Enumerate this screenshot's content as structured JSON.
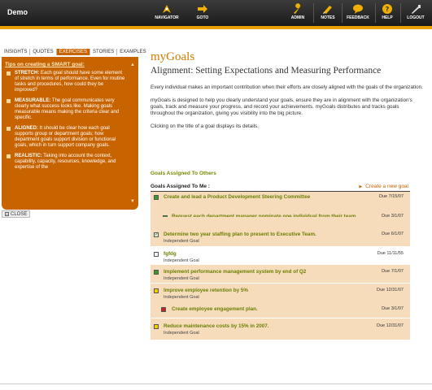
{
  "app": {
    "title": "Demo"
  },
  "nav": [
    {
      "label": "NAVIGATOR",
      "icon": "navigator-icon"
    },
    {
      "label": "GOTO",
      "icon": "goto-arrow-icon"
    },
    {
      "label": "ADMIN",
      "icon": "wrench-icon"
    },
    {
      "label": "NOTES",
      "icon": "notes-icon"
    },
    {
      "label": "FEEDBACK",
      "icon": "feedback-bubble-icon"
    },
    {
      "label": "HELP",
      "icon": "help-icon"
    },
    {
      "label": "LOGOUT",
      "icon": "logout-arrow-icon"
    }
  ],
  "colors": {
    "accent_orange": "#c86400",
    "goal_green": "#6b7f00",
    "row_shade": "#f7dcbc",
    "title_orange": "#d07c00"
  },
  "tabs": [
    "INSIGHTS",
    "QUOTES",
    "EXERCISES",
    "STORIES",
    "EXAMPLES"
  ],
  "active_tab": "EXERCISES",
  "tips": {
    "title": "Tips on creating a SMART goal:",
    "items": [
      {
        "term": "STRETCH:",
        "text": " Each goal should have some element of stretch in terms of performance. Even for routine tasks and procedures, how could they be improved?"
      },
      {
        "term": "MEASURABLE:",
        "text": " The goal communicates very clearly what success looks like. Making goals measurable means making the criteria clear and specific."
      },
      {
        "term": "ALIGNED:",
        "text": " It should be clear how each goal supports group or department goals; how department goals support division or functional goals, which in turn support company goals."
      },
      {
        "term": "REALISTIC:",
        "text": " Taking into account the context, capability, capacity, resources, knowledge, and expertise of the"
      }
    ]
  },
  "close_label": "CLOSE",
  "main": {
    "title": "myGoals",
    "subtitle": "Alignment: Setting Expectations and Measuring Performance",
    "para1": "Every individual makes an important contribution when their efforts are closely aligned with the goals of the organization.",
    "para2": "myGoals is designed to help you clearly understand your goals, ensure they are in alignment with the organization's goals, track and measure your progress, and record your achievements. myGoals distributes and tracks goals throughout the organization, giving you visibility into the big picture.",
    "para3": "Clicking on the title of a goal displays its details.",
    "section_others": "Goals Assigned To Others",
    "section_me": "Goals Assigned To Me :",
    "create_link": "Create a new goal"
  },
  "goals": [
    {
      "title": "Create and lead a Product Development Steering Committee",
      "type": "",
      "due": "Due 7/15/07",
      "status": "green",
      "indent": 0
    },
    {
      "title": "Request each department manager nominate one individual from their team.",
      "type": "",
      "due": "Due 3/1/07",
      "status": "green",
      "indent": 1
    },
    {
      "title": "Determine two year staffing plan to present to Executive Team.",
      "type": "Independent Goal",
      "due": "Due 6/1/07",
      "status": "checked",
      "indent": 0
    },
    {
      "title": "fgfdg",
      "type": "Independent Goal",
      "due": "Due 11/11/55",
      "status": "white",
      "indent": 0
    },
    {
      "title": "Implement performance management system by end of Q2",
      "type": "Independent Goal",
      "due": "Due 7/1/07",
      "status": "green",
      "indent": 0
    },
    {
      "title": "Improve employee retention by 5%",
      "type": "Independent Goal",
      "due": "Due 12/31/07",
      "status": "yellow",
      "indent": 0
    },
    {
      "title": "Create employee engagement plan.",
      "type": "",
      "due": "Due 3/1/07",
      "status": "red",
      "indent": 1
    },
    {
      "title": "Reduce maintenance costs by 15% in 2007.",
      "type": "Independent Goal",
      "due": "Due 12/31/07",
      "status": "yellow",
      "indent": 0
    }
  ]
}
